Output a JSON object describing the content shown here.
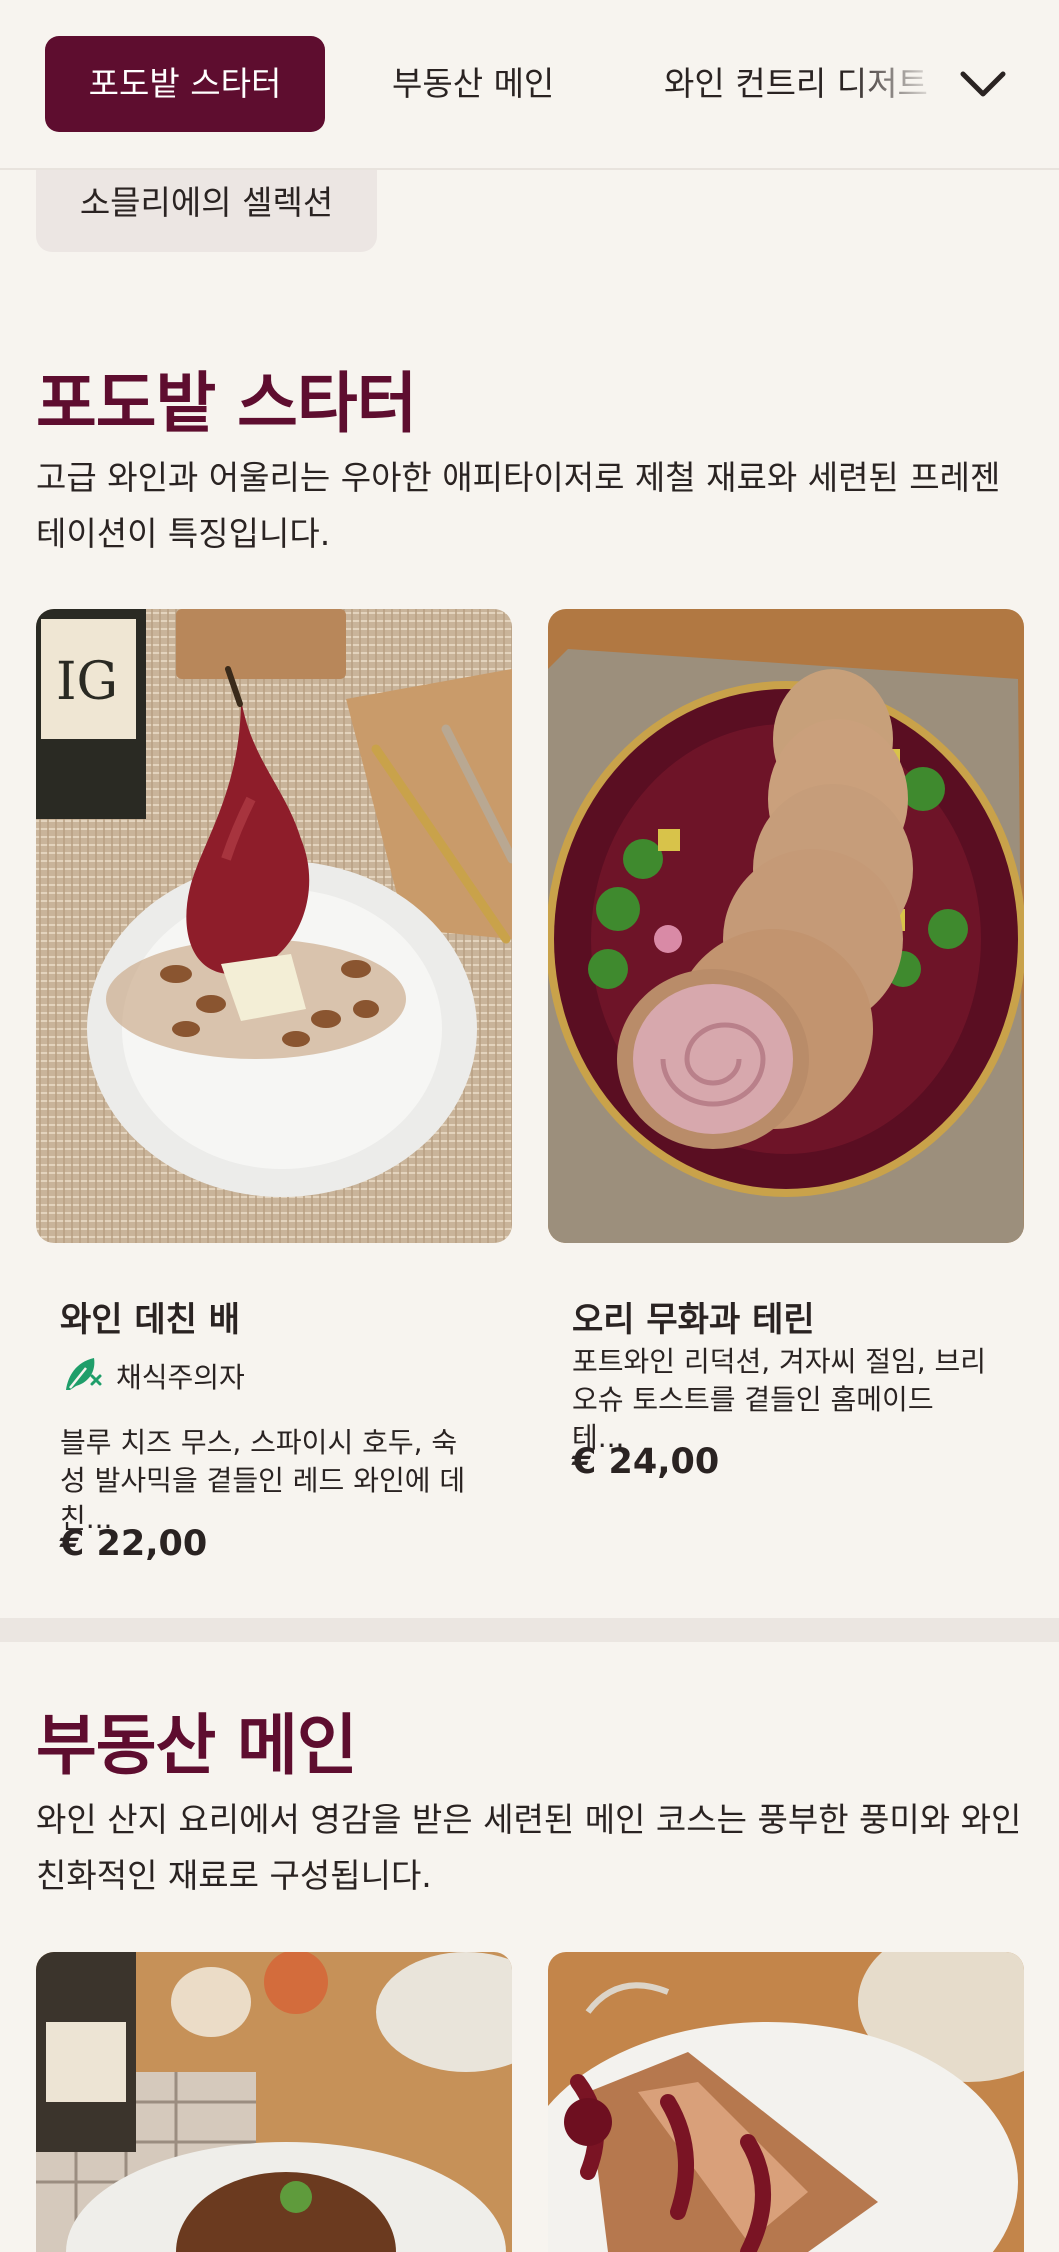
{
  "nav": {
    "tabs": [
      {
        "label": "포도밭 스타터",
        "active": true
      },
      {
        "label": "부동산 메인",
        "active": false
      },
      {
        "label": "와인 컨트리 디저트",
        "active": false
      },
      {
        "label": "소믈리에의 셀렉션",
        "active": false
      }
    ],
    "expand_icon": "chevron-down-icon"
  },
  "sections": [
    {
      "title": "포도밭 스타터",
      "description": "고급 와인과 어울리는 우아한 애피타이저로 제철 재료와 세련된 프레젠테이션이 특징입니다.",
      "dishes": [
        {
          "name": "와인 데친 배",
          "diet_label": "채식주의자",
          "diet_icon": "leaf-icon",
          "description": "블루 치즈 무스, 스파이시 호두, 숙성 발사믹을 곁들인 레드 와인에 데친...",
          "price": "€ 22,00"
        },
        {
          "name": "오리 무화과 테린",
          "description": "포트와인 리덕션, 겨자씨 절임, 브리오슈 토스트를 곁들인 홈메이드 테...",
          "price": "€ 24,00"
        }
      ]
    },
    {
      "title": "부동산 메인",
      "description": "와인 산지 요리에서 영감을 받은 세련된 메인 코스는 풍부한 풍미와 와인 친화적인 재료로 구성됩니다."
    }
  ],
  "colors": {
    "brand": "#5e0d2f",
    "background": "#f7f4ef",
    "vegetarian": "#1f9e6a"
  }
}
